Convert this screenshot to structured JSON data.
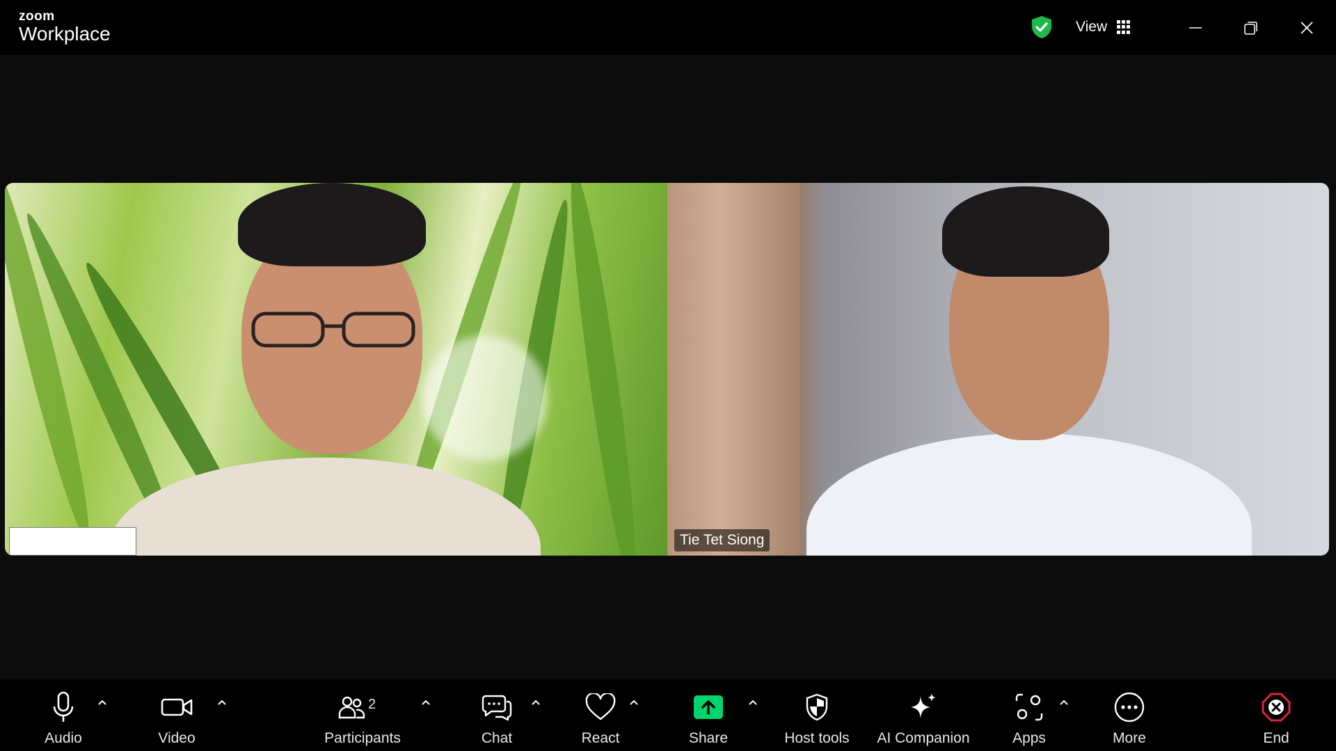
{
  "app": {
    "brand_small": "zoom",
    "brand_large": "Workplace"
  },
  "header": {
    "view_label": "View",
    "security_color": "#1fb84a"
  },
  "participants_video": [
    {
      "name": ""
    },
    {
      "name": "Tie Tet Siong"
    }
  ],
  "toolbar": {
    "audio": "Audio",
    "video": "Video",
    "participants": "Participants",
    "participant_count": "2",
    "chat": "Chat",
    "react": "React",
    "share": "Share",
    "host_tools": "Host tools",
    "ai_companion": "AI Companion",
    "apps": "Apps",
    "more": "More",
    "end": "End",
    "share_color": "#00d46a",
    "end_color": "#e0243b"
  }
}
